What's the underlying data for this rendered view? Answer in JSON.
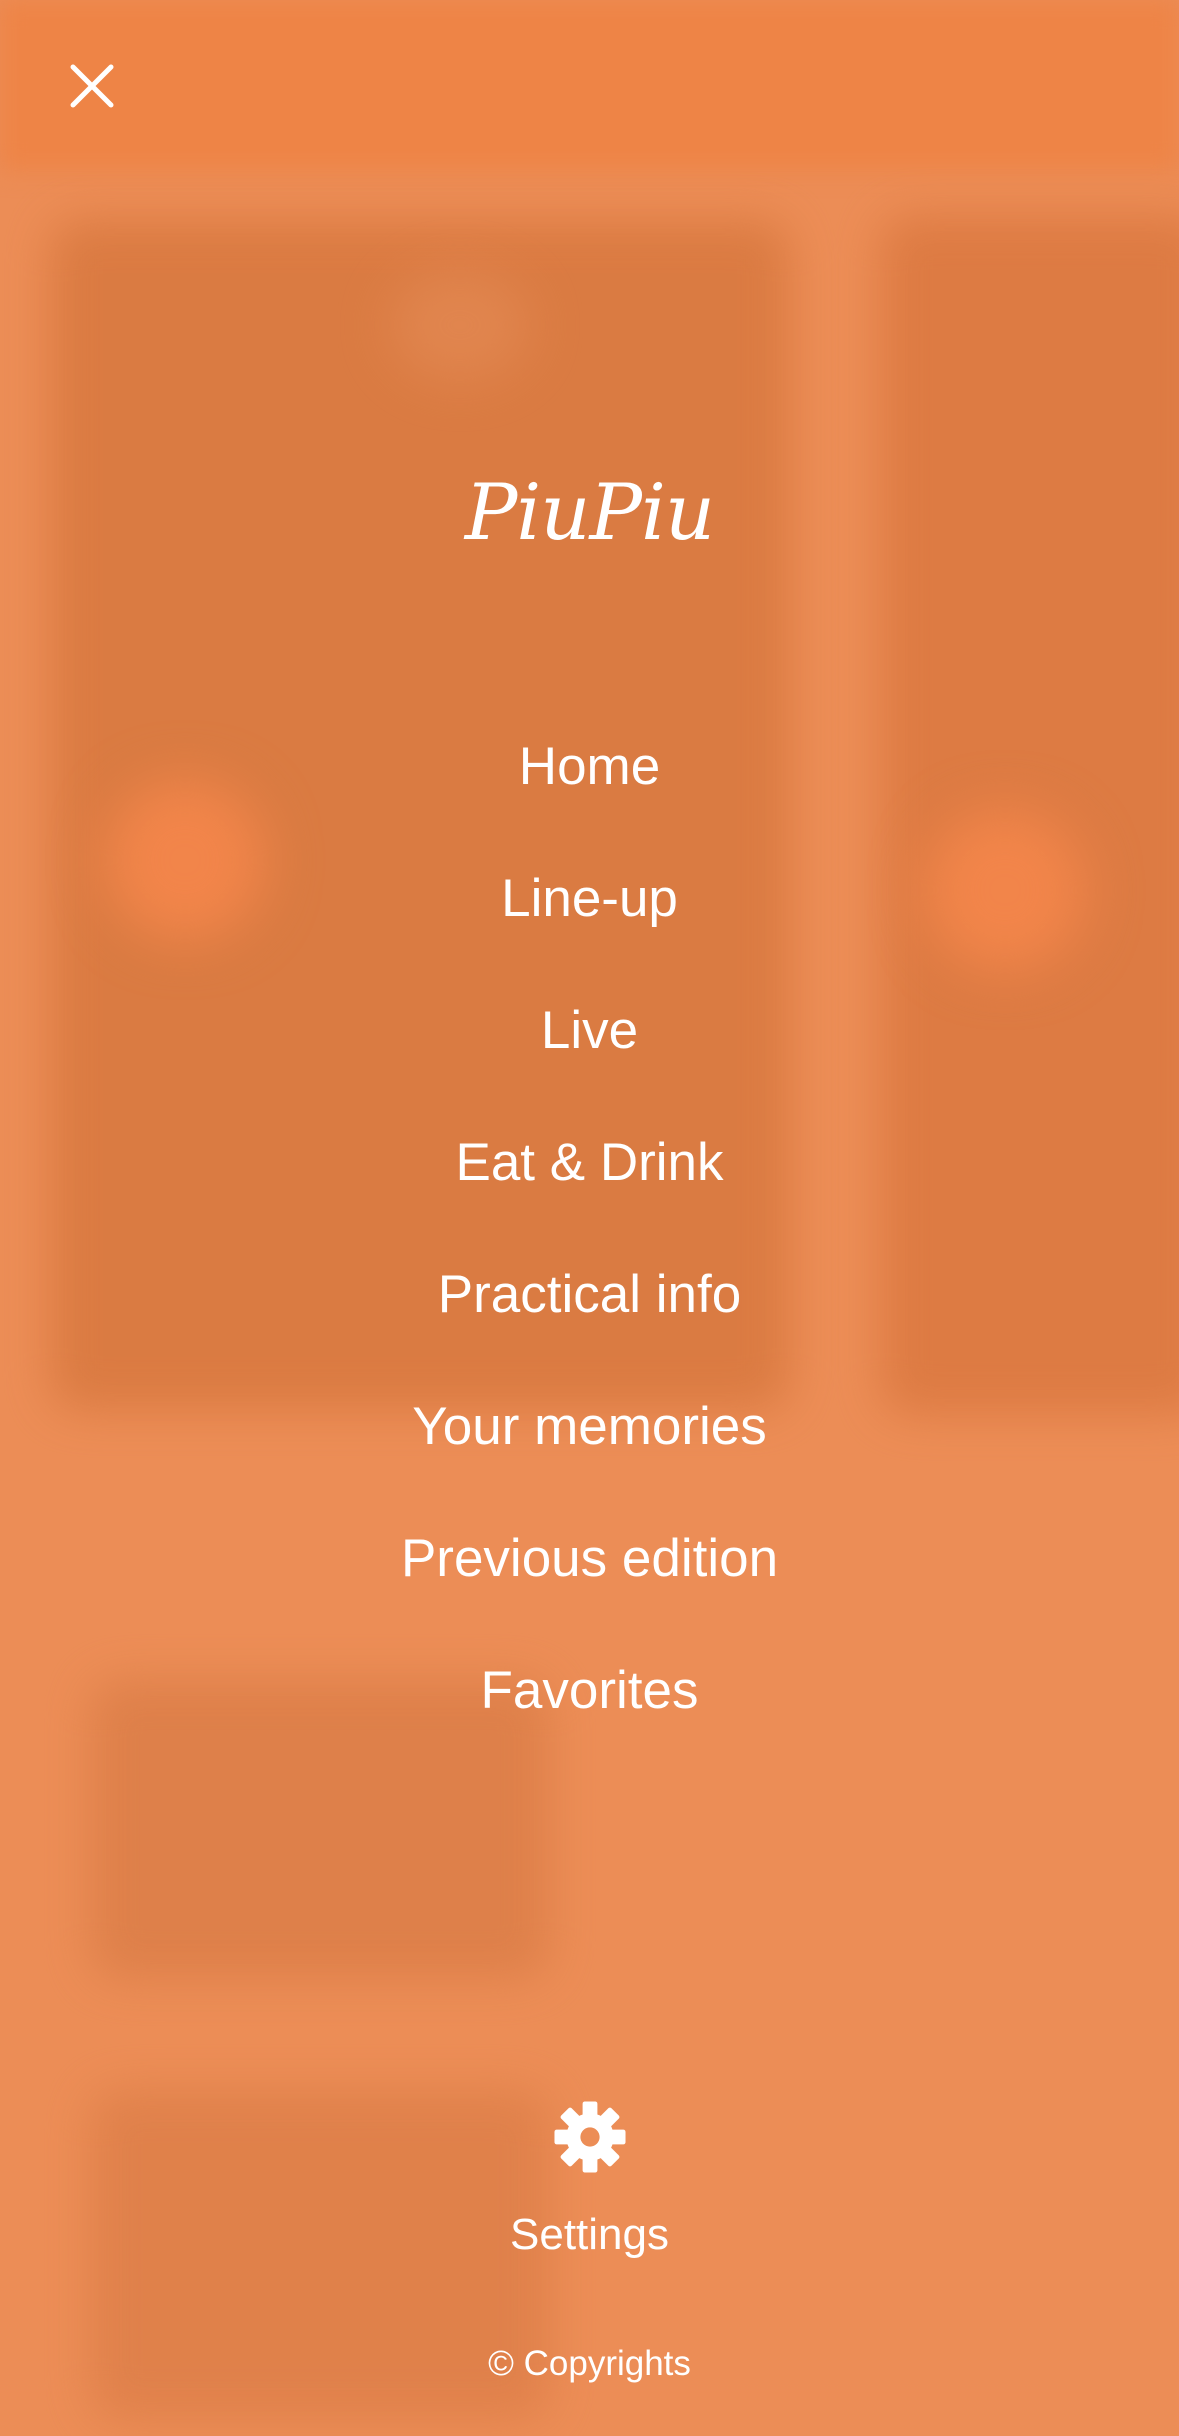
{
  "app": {
    "logo_text": "PiuPiu"
  },
  "menu": {
    "items": [
      {
        "label": "Home"
      },
      {
        "label": "Line-up"
      },
      {
        "label": "Live"
      },
      {
        "label": "Eat & Drink"
      },
      {
        "label": "Practical info"
      },
      {
        "label": "Your memories"
      },
      {
        "label": "Previous edition"
      },
      {
        "label": "Favorites"
      }
    ]
  },
  "footer": {
    "settings_label": "Settings",
    "copyright": "© Copyrights"
  },
  "icons": {
    "close": "close-icon",
    "settings": "gear-icon"
  },
  "colors": {
    "background": "#ec8d56",
    "text": "#ffffff"
  }
}
